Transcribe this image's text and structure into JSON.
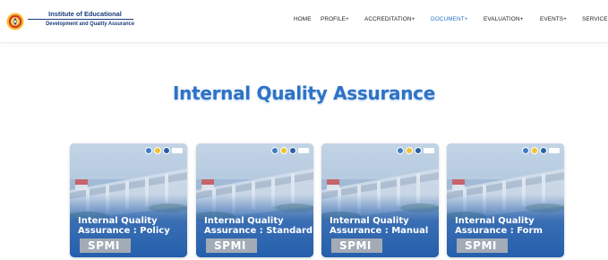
{
  "header": {
    "logo": {
      "name": "Institute of Educational",
      "subtitle": "Development and Quality Assurance"
    },
    "nav": [
      {
        "label": "HOME",
        "active": false
      },
      {
        "label": "PROFILE+",
        "active": false
      },
      {
        "label": "ACCREDITATION+",
        "active": false
      },
      {
        "label": "DOCUMENT+",
        "active": true
      },
      {
        "label": "EVALUATION+",
        "active": false
      },
      {
        "label": "EVENTS+",
        "active": false
      },
      {
        "label": "SERVICE",
        "active": false
      }
    ]
  },
  "main": {
    "title": "Internal Quality Assurance",
    "cards": [
      {
        "title_line1": "Internal Quality",
        "title_line2": "Assurance : Policy",
        "badge": "SPMI"
      },
      {
        "title_line1": "Internal Quality",
        "title_line2": "Assurance : Standard",
        "badge": "SPMI"
      },
      {
        "title_line1": "Internal Quality",
        "title_line2": "Assurance : Manual",
        "badge": "SPMI"
      },
      {
        "title_line1": "Internal Quality",
        "title_line2": "Assurance : Form",
        "badge": "SPMI"
      }
    ]
  },
  "colors": {
    "accent": "#2d72c7",
    "nav_active": "#2a74c8",
    "logo_text": "#1a3d7c",
    "card_blue": "#2e63ad",
    "badge_grey": "#a3abb6"
  },
  "icons": {
    "logo_emblem": "university-emblem-icon",
    "card_partner_logos": [
      "partner-logo-icon",
      "partner-logo-icon",
      "partner-logo-icon",
      "partner-logo-icon"
    ]
  }
}
